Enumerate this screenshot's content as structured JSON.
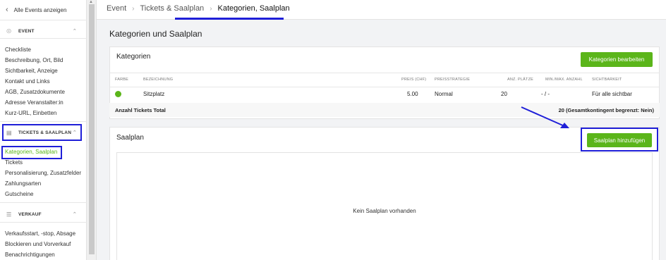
{
  "sidebar": {
    "back_label": "Alle Events anzeigen",
    "sections": {
      "event": {
        "label": "EVENT",
        "icon": "circle-info-icon"
      },
      "tickets": {
        "label": "TICKETS & SAALPLAN",
        "icon": "ticket-icon"
      },
      "verkauf": {
        "label": "VERKAUF",
        "icon": "database-icon"
      }
    },
    "event_items": [
      "Checkliste",
      "Beschreibung, Ort, Bild",
      "Sichtbarkeit, Anzeige",
      "Kontakt und Links",
      "AGB, Zusatzdokumente",
      "Adresse Veranstalter:in",
      "Kurz-URL, Einbetten"
    ],
    "ticket_items": [
      "Kategorien, Saalplan",
      "Tickets",
      "Personalisierung, Zusatzfelder",
      "Zahlungsarten",
      "Gutscheine"
    ],
    "verkauf_items": [
      "Verkaufsstart, -stop, Absage",
      "Blockieren und Vorverkauf",
      "Benachrichtigungen"
    ]
  },
  "breadcrumb": [
    "Event",
    "Tickets & Saalplan",
    "Kategorien, Saalplan"
  ],
  "page_title": "Kategorien und Saalplan",
  "kategorien": {
    "title": "Kategorien",
    "edit_button": "Kategorien bearbeiten",
    "columns": [
      "FARBE",
      "BEZEICHNUNG",
      "PREIS (CHF)",
      "PREISSTRATEGIE",
      "ANZ. PLÄTZE",
      "MIN./MAX. ANZAHL",
      "SICHTBARKEIT"
    ],
    "rows": [
      {
        "color": "#5bb51a",
        "name": "Sitzplatz",
        "price": "5.00",
        "strategy": "Normal",
        "seats": "20",
        "minmax": "- / -",
        "visibility": "Für alle sichtbar"
      }
    ],
    "total_label": "Anzahl Tickets Total",
    "total_value": "20 (Gesamtkontingent begrenzt: Nein)"
  },
  "saalplan": {
    "title": "Saalplan",
    "add_button": "Saalplan hinzufügen",
    "empty_message": "Kein Saalplan vorhanden"
  },
  "colors": {
    "accent": "#5bb51a",
    "highlight": "#1f1fd8"
  }
}
